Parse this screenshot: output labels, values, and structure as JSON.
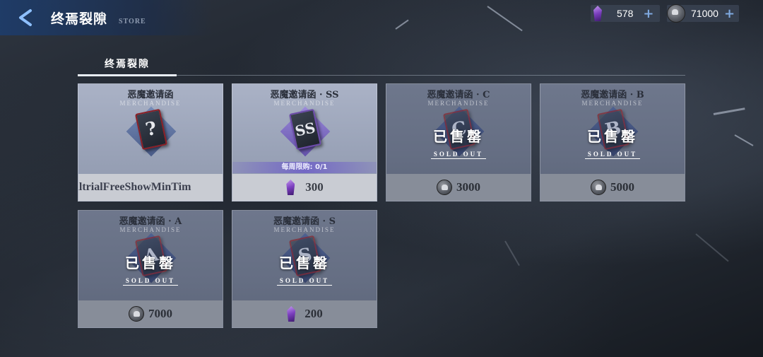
{
  "header": {
    "title": "终焉裂隙",
    "subtitle": "STORE"
  },
  "currencies": [
    {
      "icon": "purple-gem-icon",
      "amount": "578"
    },
    {
      "icon": "skull-coin-icon",
      "amount": "71000"
    }
  ],
  "tabs": [
    {
      "label": "终焉裂隙",
      "active": true
    }
  ],
  "cards": [
    {
      "name": "恶魔邀请函",
      "sub": "MERCHANDISE",
      "letter": "?",
      "sold": false,
      "limit": "",
      "price": "",
      "price_text": "naltrialFreeShowMinTim",
      "currency_icon": ""
    },
    {
      "name": "恶魔邀请函 · SS",
      "sub": "MERCHANDISE",
      "letter": "SS",
      "sold": false,
      "limit": "每周限购: 0/1",
      "price": "300",
      "currency_icon": "purple-gem-icon"
    },
    {
      "name": "恶魔邀请函 · C",
      "sub": "MERCHANDISE",
      "letter": "C",
      "sold": true,
      "sold_main": "已售罄",
      "sold_sub": "SOLD OUT",
      "price": "3000",
      "currency_icon": "skull-coin-icon"
    },
    {
      "name": "恶魔邀请函 · B",
      "sub": "MERCHANDISE",
      "letter": "B",
      "sold": true,
      "sold_main": "已售罄",
      "sold_sub": "SOLD OUT",
      "price": "5000",
      "currency_icon": "skull-coin-icon"
    },
    {
      "name": "恶魔邀请函 · A",
      "sub": "MERCHANDISE",
      "letter": "A",
      "sold": true,
      "sold_main": "已售罄",
      "sold_sub": "SOLD OUT",
      "price": "7000",
      "currency_icon": "skull-coin-icon"
    },
    {
      "name": "恶魔邀请函 · S",
      "sub": "MERCHANDISE",
      "letter": "S",
      "sold": true,
      "sold_main": "已售罄",
      "sold_sub": "SOLD OUT",
      "price": "200",
      "currency_icon": "purple-gem-icon"
    }
  ]
}
